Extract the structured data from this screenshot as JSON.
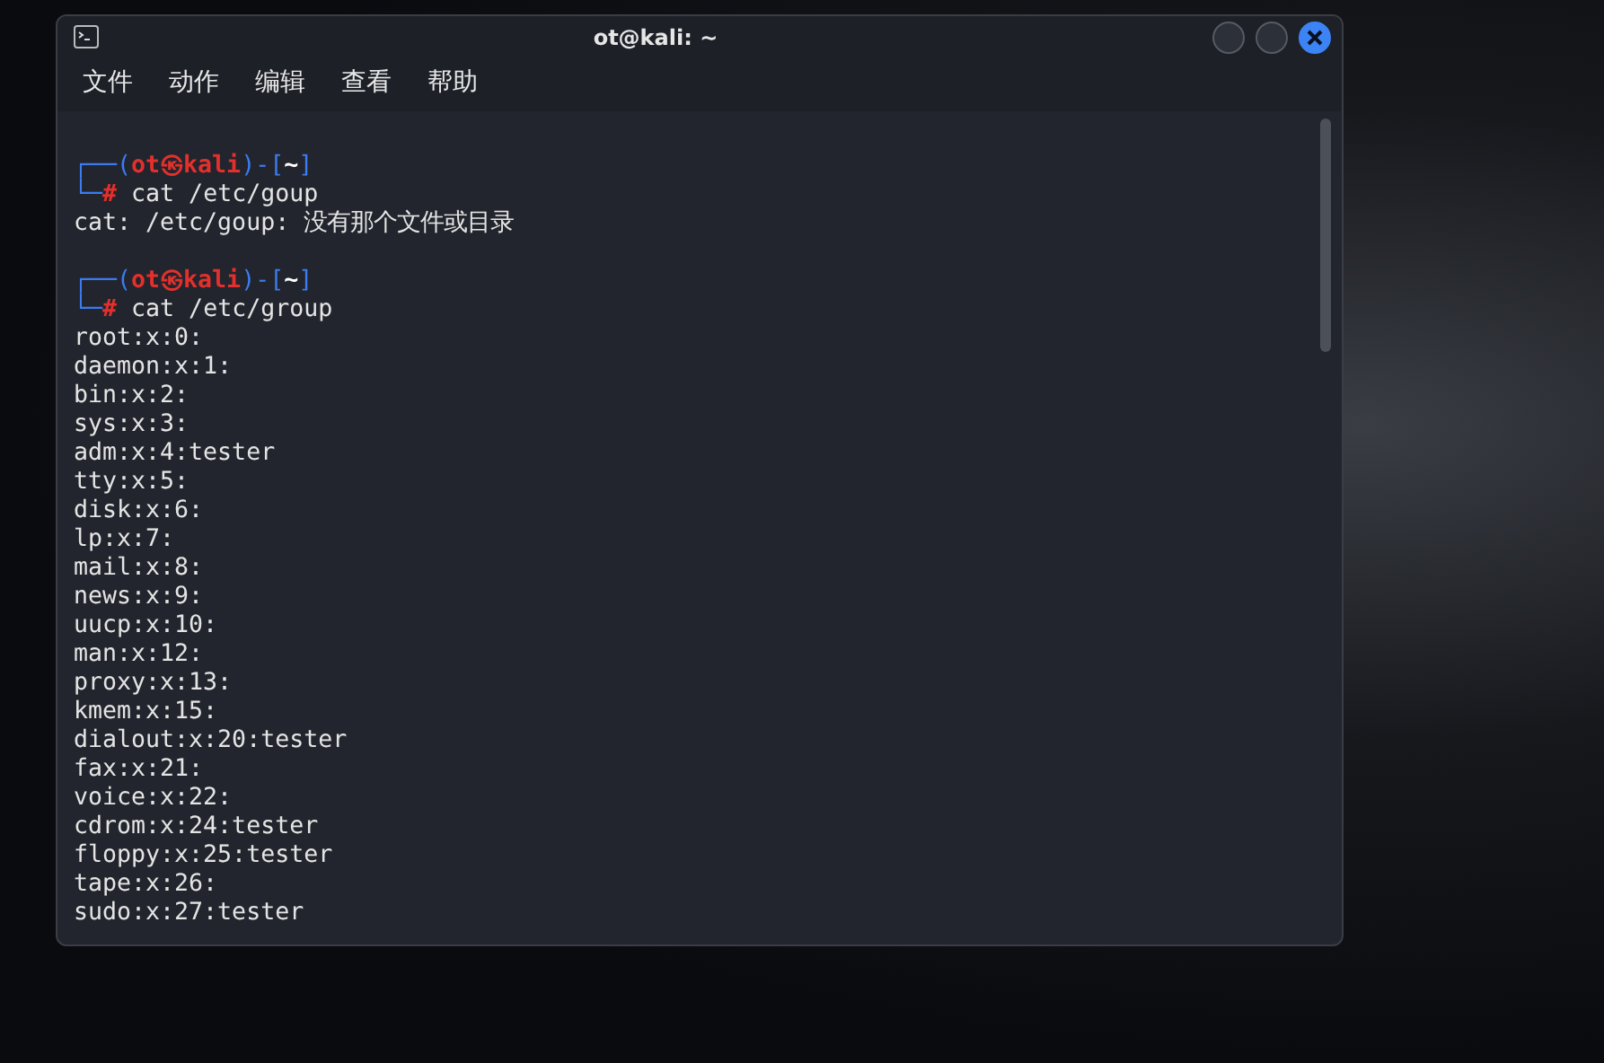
{
  "window": {
    "title": "ot@kali: ~"
  },
  "menu": [
    {
      "label": "文件"
    },
    {
      "label": "动作"
    },
    {
      "label": "编辑"
    },
    {
      "label": "查看"
    },
    {
      "label": "帮助"
    }
  ],
  "terminal": {
    "lines": [
      {
        "kind": "blank"
      },
      {
        "kind": "prompt",
        "top": [
          {
            "kind": "frame",
            "text": "┌──("
          },
          {
            "kind": "user",
            "text": "ot㉿kali"
          },
          {
            "kind": "frame",
            "text": ")-["
          },
          {
            "kind": "dir",
            "text": "~"
          },
          {
            "kind": "frame",
            "text": "]"
          }
        ],
        "corner": "└─",
        "symbol": "#",
        "command": "cat /etc/goup"
      },
      {
        "kind": "output",
        "text": "cat: /etc/goup: 没有那个文件或目录"
      },
      {
        "kind": "blank"
      },
      {
        "kind": "prompt",
        "top": [
          {
            "kind": "frame",
            "text": "┌──("
          },
          {
            "kind": "user",
            "text": "ot㉿kali"
          },
          {
            "kind": "frame",
            "text": ")-["
          },
          {
            "kind": "dir",
            "text": "~"
          },
          {
            "kind": "frame",
            "text": "]"
          }
        ],
        "corner": "└─",
        "symbol": "#",
        "command": "cat /etc/group"
      },
      {
        "kind": "output",
        "text": "root:x:0:"
      },
      {
        "kind": "output",
        "text": "daemon:x:1:"
      },
      {
        "kind": "output",
        "text": "bin:x:2:"
      },
      {
        "kind": "output",
        "text": "sys:x:3:"
      },
      {
        "kind": "output",
        "text": "adm:x:4:tester"
      },
      {
        "kind": "output",
        "text": "tty:x:5:"
      },
      {
        "kind": "output",
        "text": "disk:x:6:"
      },
      {
        "kind": "output",
        "text": "lp:x:7:"
      },
      {
        "kind": "output",
        "text": "mail:x:8:"
      },
      {
        "kind": "output",
        "text": "news:x:9:"
      },
      {
        "kind": "output",
        "text": "uucp:x:10:"
      },
      {
        "kind": "output",
        "text": "man:x:12:"
      },
      {
        "kind": "output",
        "text": "proxy:x:13:"
      },
      {
        "kind": "output",
        "text": "kmem:x:15:"
      },
      {
        "kind": "output",
        "text": "dialout:x:20:tester"
      },
      {
        "kind": "output",
        "text": "fax:x:21:"
      },
      {
        "kind": "output",
        "text": "voice:x:22:"
      },
      {
        "kind": "output",
        "text": "cdrom:x:24:tester"
      },
      {
        "kind": "output",
        "text": "floppy:x:25:tester"
      },
      {
        "kind": "output",
        "text": "tape:x:26:"
      },
      {
        "kind": "output",
        "text": "sudo:x:27:tester"
      }
    ]
  }
}
